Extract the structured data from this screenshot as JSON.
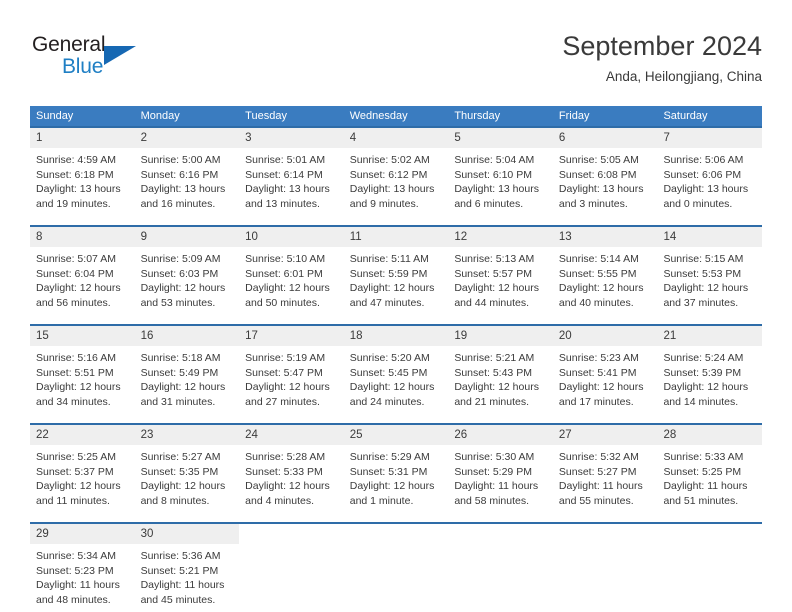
{
  "brand": {
    "name_part1": "General",
    "name_part2": "Blue",
    "logo_icon": "blue-triangle-logo"
  },
  "header": {
    "title": "September 2024",
    "subtitle": "Anda, Heilongjiang, China"
  },
  "colors": {
    "header_blue": "#3a7cc0",
    "row_border_blue": "#2e6ca8",
    "daynum_band": "#efefef",
    "brand_blue": "#1f7fc4",
    "text": "#3b3b3b"
  },
  "weekdays": [
    "Sunday",
    "Monday",
    "Tuesday",
    "Wednesday",
    "Thursday",
    "Friday",
    "Saturday"
  ],
  "weeks": [
    [
      {
        "day": "1",
        "lines": [
          "Sunrise: 4:59 AM",
          "Sunset: 6:18 PM",
          "Daylight: 13 hours",
          "and 19 minutes."
        ]
      },
      {
        "day": "2",
        "lines": [
          "Sunrise: 5:00 AM",
          "Sunset: 6:16 PM",
          "Daylight: 13 hours",
          "and 16 minutes."
        ]
      },
      {
        "day": "3",
        "lines": [
          "Sunrise: 5:01 AM",
          "Sunset: 6:14 PM",
          "Daylight: 13 hours",
          "and 13 minutes."
        ]
      },
      {
        "day": "4",
        "lines": [
          "Sunrise: 5:02 AM",
          "Sunset: 6:12 PM",
          "Daylight: 13 hours",
          "and 9 minutes."
        ]
      },
      {
        "day": "5",
        "lines": [
          "Sunrise: 5:04 AM",
          "Sunset: 6:10 PM",
          "Daylight: 13 hours",
          "and 6 minutes."
        ]
      },
      {
        "day": "6",
        "lines": [
          "Sunrise: 5:05 AM",
          "Sunset: 6:08 PM",
          "Daylight: 13 hours",
          "and 3 minutes."
        ]
      },
      {
        "day": "7",
        "lines": [
          "Sunrise: 5:06 AM",
          "Sunset: 6:06 PM",
          "Daylight: 13 hours",
          "and 0 minutes."
        ]
      }
    ],
    [
      {
        "day": "8",
        "lines": [
          "Sunrise: 5:07 AM",
          "Sunset: 6:04 PM",
          "Daylight: 12 hours",
          "and 56 minutes."
        ]
      },
      {
        "day": "9",
        "lines": [
          "Sunrise: 5:09 AM",
          "Sunset: 6:03 PM",
          "Daylight: 12 hours",
          "and 53 minutes."
        ]
      },
      {
        "day": "10",
        "lines": [
          "Sunrise: 5:10 AM",
          "Sunset: 6:01 PM",
          "Daylight: 12 hours",
          "and 50 minutes."
        ]
      },
      {
        "day": "11",
        "lines": [
          "Sunrise: 5:11 AM",
          "Sunset: 5:59 PM",
          "Daylight: 12 hours",
          "and 47 minutes."
        ]
      },
      {
        "day": "12",
        "lines": [
          "Sunrise: 5:13 AM",
          "Sunset: 5:57 PM",
          "Daylight: 12 hours",
          "and 44 minutes."
        ]
      },
      {
        "day": "13",
        "lines": [
          "Sunrise: 5:14 AM",
          "Sunset: 5:55 PM",
          "Daylight: 12 hours",
          "and 40 minutes."
        ]
      },
      {
        "day": "14",
        "lines": [
          "Sunrise: 5:15 AM",
          "Sunset: 5:53 PM",
          "Daylight: 12 hours",
          "and 37 minutes."
        ]
      }
    ],
    [
      {
        "day": "15",
        "lines": [
          "Sunrise: 5:16 AM",
          "Sunset: 5:51 PM",
          "Daylight: 12 hours",
          "and 34 minutes."
        ]
      },
      {
        "day": "16",
        "lines": [
          "Sunrise: 5:18 AM",
          "Sunset: 5:49 PM",
          "Daylight: 12 hours",
          "and 31 minutes."
        ]
      },
      {
        "day": "17",
        "lines": [
          "Sunrise: 5:19 AM",
          "Sunset: 5:47 PM",
          "Daylight: 12 hours",
          "and 27 minutes."
        ]
      },
      {
        "day": "18",
        "lines": [
          "Sunrise: 5:20 AM",
          "Sunset: 5:45 PM",
          "Daylight: 12 hours",
          "and 24 minutes."
        ]
      },
      {
        "day": "19",
        "lines": [
          "Sunrise: 5:21 AM",
          "Sunset: 5:43 PM",
          "Daylight: 12 hours",
          "and 21 minutes."
        ]
      },
      {
        "day": "20",
        "lines": [
          "Sunrise: 5:23 AM",
          "Sunset: 5:41 PM",
          "Daylight: 12 hours",
          "and 17 minutes."
        ]
      },
      {
        "day": "21",
        "lines": [
          "Sunrise: 5:24 AM",
          "Sunset: 5:39 PM",
          "Daylight: 12 hours",
          "and 14 minutes."
        ]
      }
    ],
    [
      {
        "day": "22",
        "lines": [
          "Sunrise: 5:25 AM",
          "Sunset: 5:37 PM",
          "Daylight: 12 hours",
          "and 11 minutes."
        ]
      },
      {
        "day": "23",
        "lines": [
          "Sunrise: 5:27 AM",
          "Sunset: 5:35 PM",
          "Daylight: 12 hours",
          "and 8 minutes."
        ]
      },
      {
        "day": "24",
        "lines": [
          "Sunrise: 5:28 AM",
          "Sunset: 5:33 PM",
          "Daylight: 12 hours",
          "and 4 minutes."
        ]
      },
      {
        "day": "25",
        "lines": [
          "Sunrise: 5:29 AM",
          "Sunset: 5:31 PM",
          "Daylight: 12 hours",
          "and 1 minute."
        ]
      },
      {
        "day": "26",
        "lines": [
          "Sunrise: 5:30 AM",
          "Sunset: 5:29 PM",
          "Daylight: 11 hours",
          "and 58 minutes."
        ]
      },
      {
        "day": "27",
        "lines": [
          "Sunrise: 5:32 AM",
          "Sunset: 5:27 PM",
          "Daylight: 11 hours",
          "and 55 minutes."
        ]
      },
      {
        "day": "28",
        "lines": [
          "Sunrise: 5:33 AM",
          "Sunset: 5:25 PM",
          "Daylight: 11 hours",
          "and 51 minutes."
        ]
      }
    ],
    [
      {
        "day": "29",
        "lines": [
          "Sunrise: 5:34 AM",
          "Sunset: 5:23 PM",
          "Daylight: 11 hours",
          "and 48 minutes."
        ]
      },
      {
        "day": "30",
        "lines": [
          "Sunrise: 5:36 AM",
          "Sunset: 5:21 PM",
          "Daylight: 11 hours",
          "and 45 minutes."
        ]
      },
      {
        "day": "",
        "lines": []
      },
      {
        "day": "",
        "lines": []
      },
      {
        "day": "",
        "lines": []
      },
      {
        "day": "",
        "lines": []
      },
      {
        "day": "",
        "lines": []
      }
    ]
  ]
}
